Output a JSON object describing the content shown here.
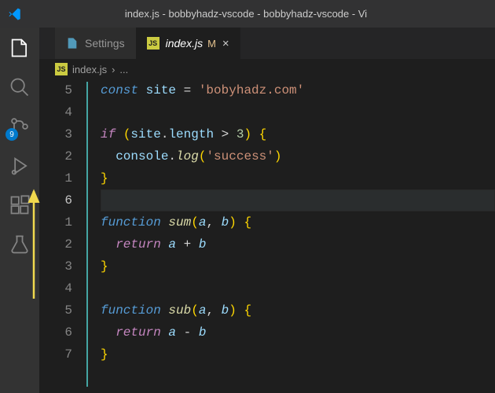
{
  "title": "index.js - bobbyhadz-vscode - bobbyhadz-vscode - Vi",
  "tabs": {
    "settings": {
      "label": "Settings"
    },
    "index": {
      "label": "index.js",
      "modified": "M"
    }
  },
  "breadcrumbs": {
    "file": "index.js",
    "sep": "›",
    "more": "..."
  },
  "activitybar": {
    "scm_badge": "9"
  },
  "gutter": [
    "5",
    "4",
    "3",
    "2",
    "1",
    "6",
    "1",
    "2",
    "3",
    "4",
    "5",
    "6",
    "7"
  ],
  "code": {
    "l1_kw": "const",
    "l1_var": " site ",
    "l1_eq": "= ",
    "l1_str": "'bobyhadz.com'",
    "l3_if": "if ",
    "l3_open": "(",
    "l3_site": "site",
    "l3_dot": ".",
    "l3_length": "length ",
    "l3_gt": "> ",
    "l3_num": "3",
    "l3_close": ") ",
    "l3_brace": "{",
    "l4_indent": "  ",
    "l4_console": "console",
    "l4_dot": ".",
    "l4_log": "log",
    "l4_open": "(",
    "l4_str": "'success'",
    "l4_close": ")",
    "l5_brace": "}",
    "l7_fn": "function ",
    "l7_name": "sum",
    "l7_open": "(",
    "l7_a": "a",
    "l7_comma": ", ",
    "l7_b": "b",
    "l7_close": ") ",
    "l7_brace": "{",
    "l8_indent": "  ",
    "l8_ret": "return ",
    "l8_a": "a ",
    "l8_plus": "+ ",
    "l8_b": "b",
    "l9_brace": "}",
    "l11_fn": "function ",
    "l11_name": "sub",
    "l11_open": "(",
    "l11_a": "a",
    "l11_comma": ", ",
    "l11_b": "b",
    "l11_close": ") ",
    "l11_brace": "{",
    "l12_indent": "  ",
    "l12_ret": "return ",
    "l12_a": "a ",
    "l12_minus": "- ",
    "l12_b": "b",
    "l13_brace": "}"
  }
}
